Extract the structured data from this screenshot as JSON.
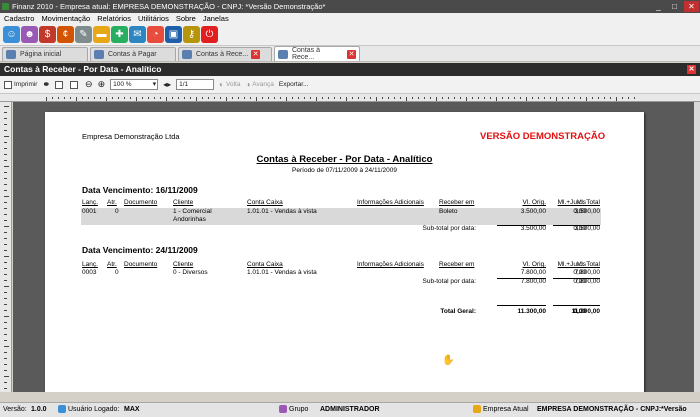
{
  "window": {
    "title": "Finanz 2010 - Empresa atual: EMPRESA DEMONSTRAÇÃO - CNPJ:  *Versão Demonstração*",
    "minimize": "_",
    "maximize": "□",
    "close": "✕"
  },
  "menu": [
    "Cadastro",
    "Movimentação",
    "Relatórios",
    "Utilitários",
    "Sobre",
    "Janelas"
  ],
  "toolbar_icons": [
    {
      "name": "users-icon",
      "color": "#3a8fd8"
    },
    {
      "name": "people-icon",
      "color": "#9b59b6"
    },
    {
      "name": "money-bag-icon",
      "color": "#c0392b"
    },
    {
      "name": "coins-icon",
      "color": "#d35400"
    },
    {
      "name": "pen-icon",
      "color": "#7f8c8d"
    },
    {
      "name": "folder-icon",
      "color": "#e6a817"
    },
    {
      "name": "puzzle-icon",
      "color": "#27ae60"
    },
    {
      "name": "email-icon",
      "color": "#2e86c1"
    },
    {
      "name": "pie-chart-icon",
      "color": "#e74c3c"
    },
    {
      "name": "save-icon",
      "color": "#1f5fa8"
    },
    {
      "name": "key-icon",
      "color": "#b7950b"
    },
    {
      "name": "power-icon",
      "color": "#e02020"
    }
  ],
  "tabs": [
    {
      "label": "Página inicial",
      "active": false
    },
    {
      "label": "Contas à Pagar",
      "active": false
    },
    {
      "label": "Contas à Rece...",
      "active": false
    },
    {
      "label": "Contas à Rece...",
      "active": true
    }
  ],
  "report_bar": {
    "title": "Contas à Receber - Por Data - Analítico",
    "close": "✕"
  },
  "viewer": {
    "print_label": "Imprimir",
    "zoom_value": "100 %",
    "page_value": "1/1",
    "back_label": "Volta",
    "forward_label": "Avança",
    "export_label": "Exportar..."
  },
  "report": {
    "company": "Empresa Demonstração Ltda",
    "version_mark": "VERSÃO DEMONSTRAÇÃO",
    "title": "Contas à Receber - Por Data - Analítico",
    "period": "Período de 07/11/2009 à 24/11/2009",
    "headers": {
      "lanc": "Lanç.",
      "atr": "Atr.",
      "doc": "Documento",
      "cliente": "Cliente",
      "conta": "Conta Caixa",
      "info": "Informações Adicionais",
      "receber": "Receber em",
      "orig": "Vl. Orig.",
      "juros": "Ml.+Juros",
      "total": "Vl. Total"
    },
    "groups": [
      {
        "title": "Data Vencimento: 16/11/2009",
        "row": {
          "lanc": "0001",
          "atr": "0",
          "doc": "",
          "cliente_l1": "1 - Comercial",
          "cliente_l2": "Andorinhas",
          "conta": "1.01.01 - Vendas à vista",
          "info": "",
          "receber": "Boleto",
          "orig": "3.500,00",
          "juros": "0,00",
          "total": "3.500,00"
        },
        "subtotal_label": "Sub-total por data:",
        "subtotal": {
          "orig": "3.500,00",
          "juros": "0,00",
          "total": "3.500,00"
        }
      },
      {
        "title": "Data Vencimento: 24/11/2009",
        "row": {
          "lanc": "0003",
          "atr": "0",
          "doc": "",
          "cliente_l1": "0 - Diversos",
          "cliente_l2": "",
          "conta": "1.01.01 - Vendas à vista",
          "info": "",
          "receber": "",
          "orig": "7.800,00",
          "juros": "0,00",
          "total": "7.800,00"
        },
        "subtotal_label": "Sub-total por data:",
        "subtotal": {
          "orig": "7.800,00",
          "juros": "0,00",
          "total": "7.800,00"
        }
      }
    ],
    "total_label": "Total Geral:",
    "total": {
      "orig": "11.300,00",
      "juros": "0,00",
      "total": "11.300,00"
    }
  },
  "status": {
    "version_label": "Versão:",
    "version_value": "1.0.0",
    "user_label": "Usuário Logado:",
    "user_value": "MAX",
    "group_label": "Grupo",
    "group_value": "ADMINISTRADOR",
    "company_label": "Empresa Atual",
    "company_value": "EMPRESA DEMONSTRAÇÃO - CNPJ:",
    "version_mark": "*Versão"
  }
}
